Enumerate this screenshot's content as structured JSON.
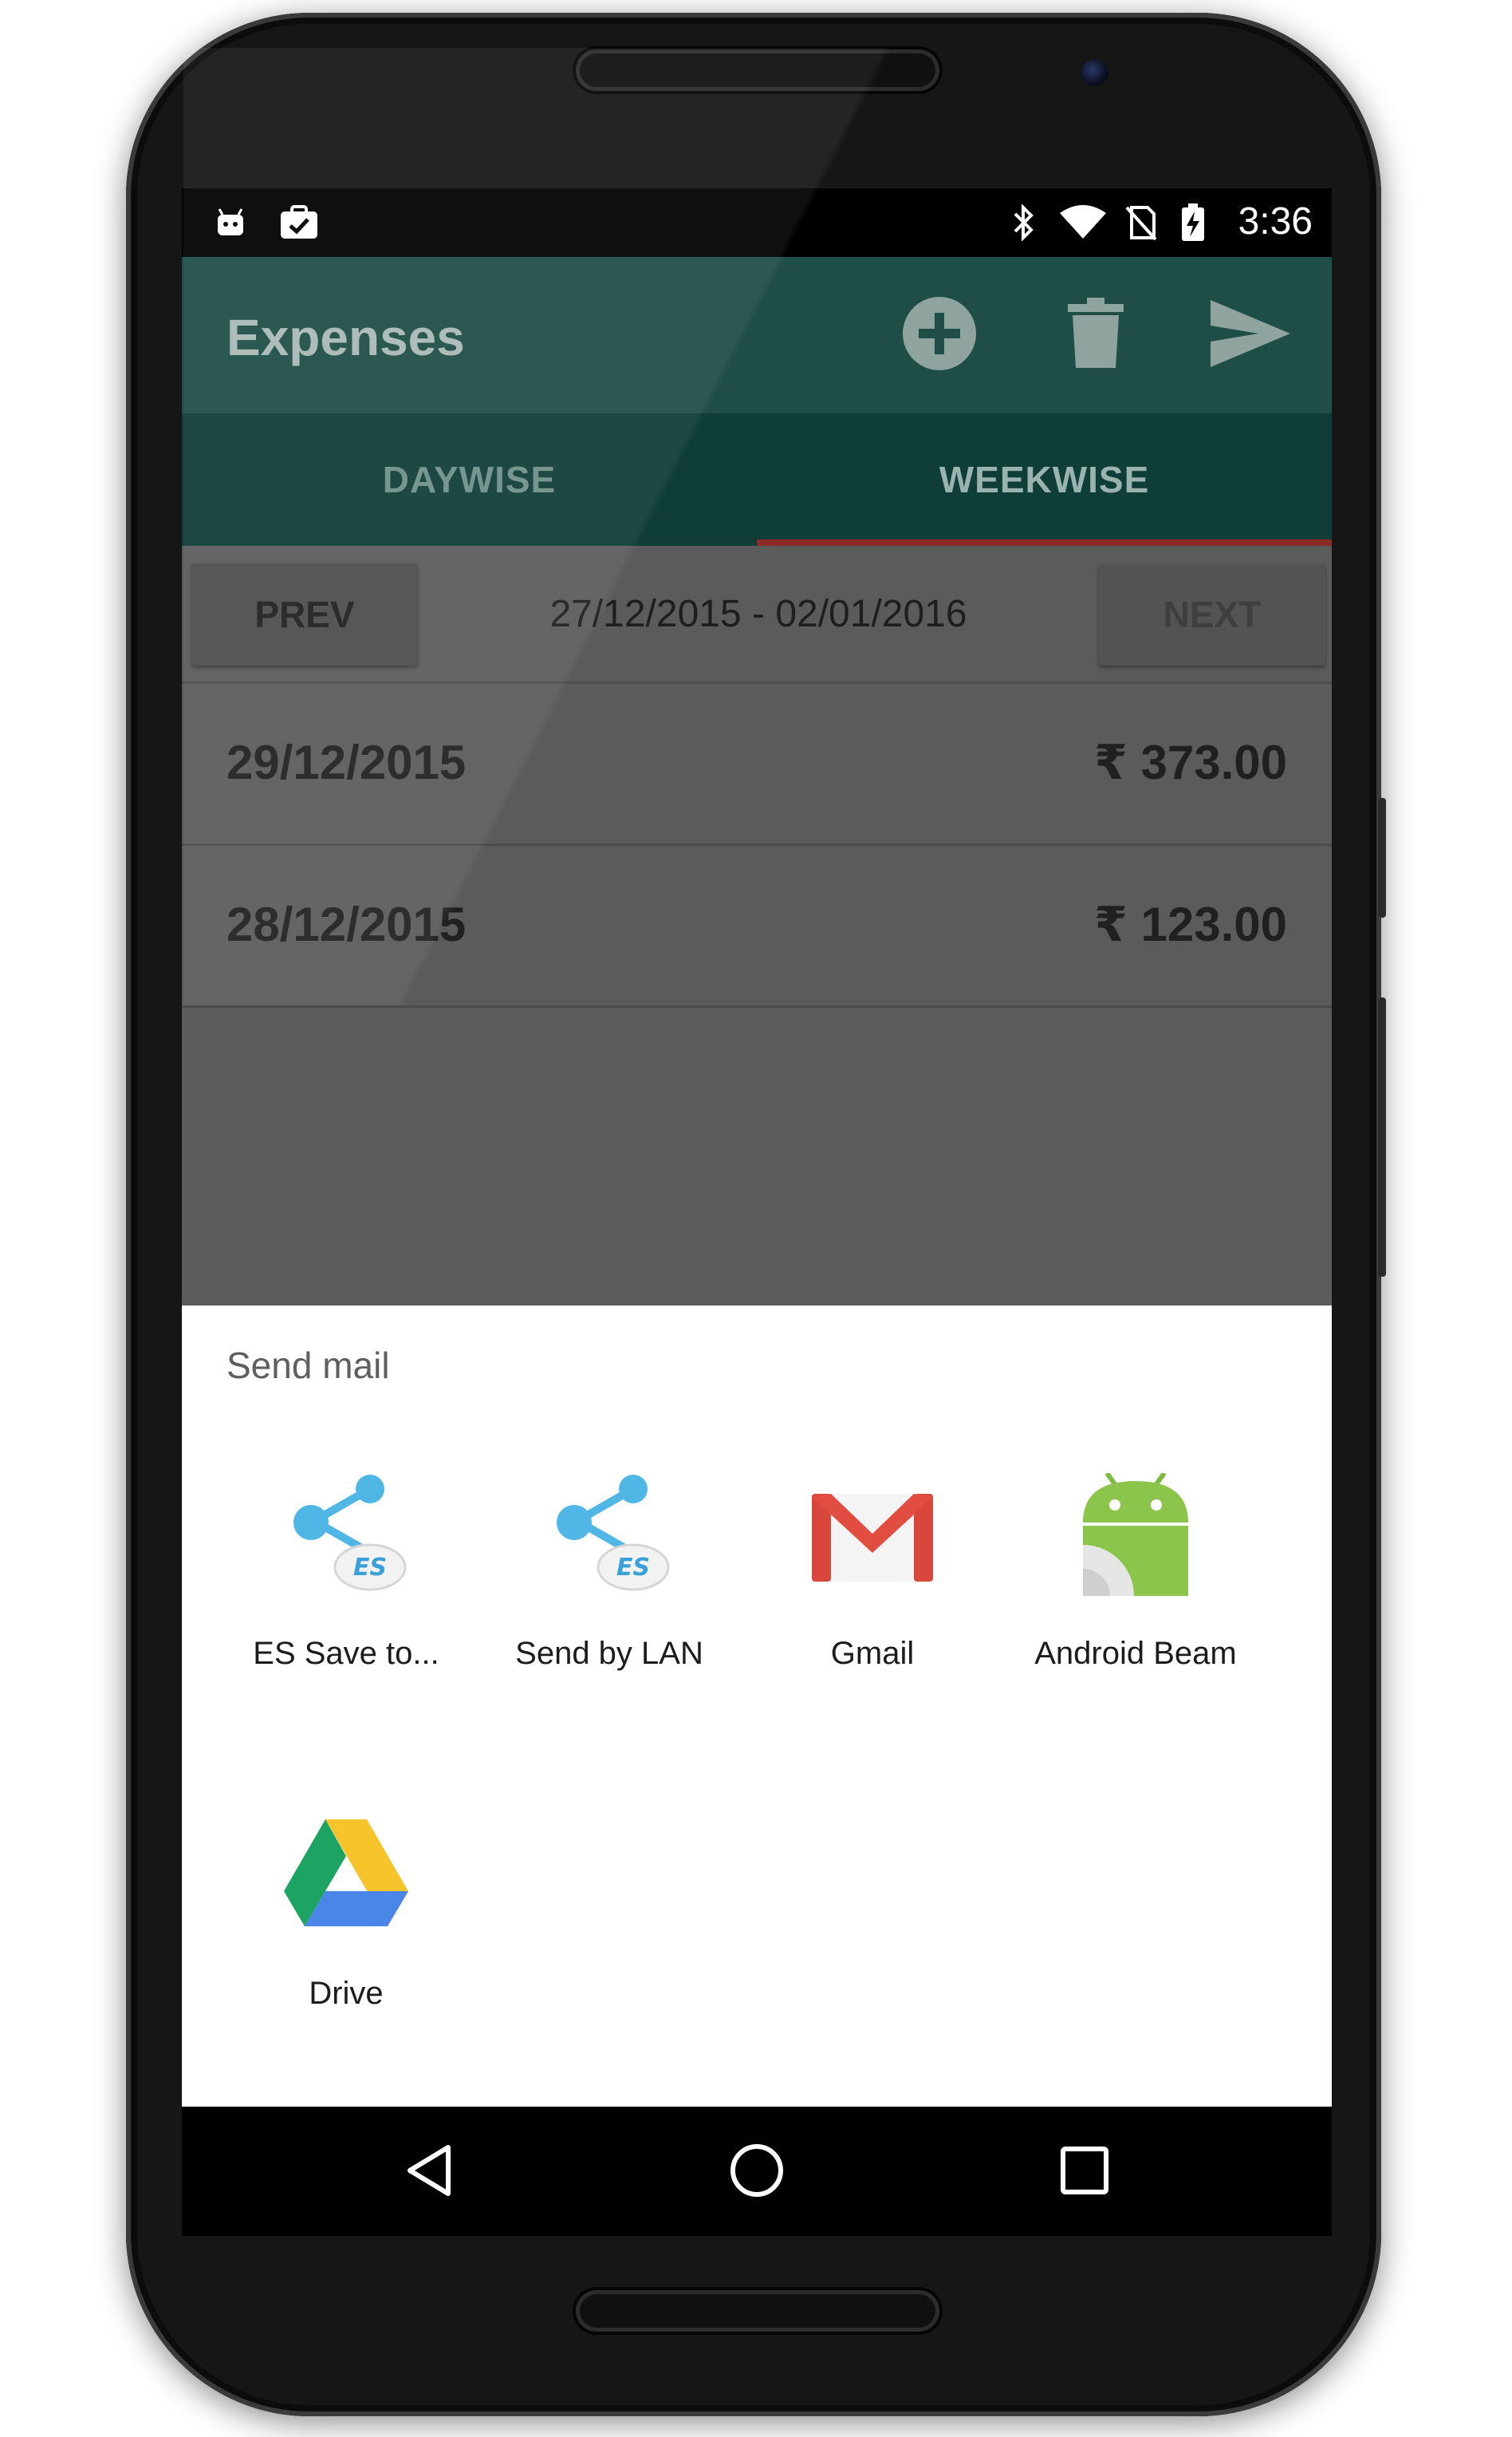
{
  "status_bar": {
    "time": "3:36",
    "left_icons": [
      "android-notification-icon",
      "clipboard-check-icon"
    ],
    "right_icons": [
      "bluetooth-icon",
      "wifi-icon",
      "no-sim-icon",
      "battery-charging-icon"
    ]
  },
  "app_bar": {
    "title": "Expenses",
    "actions": [
      "add-circle-icon",
      "delete-icon",
      "send-icon"
    ],
    "color": "#1f4e47"
  },
  "tabs": [
    {
      "label": "DAYWISE",
      "active": false
    },
    {
      "label": "WEEKWISE",
      "active": true
    }
  ],
  "week_nav": {
    "prev_label": "PREV",
    "next_label": "NEXT",
    "range": "27/12/2015 - 02/01/2016"
  },
  "expenses": [
    {
      "date": "29/12/2015",
      "amount": "₹ 373.00"
    },
    {
      "date": "28/12/2015",
      "amount": "₹ 123.00"
    }
  ],
  "share_sheet": {
    "title": "Send mail",
    "targets": [
      {
        "label": "ES Save to...",
        "icon": "es-share-icon"
      },
      {
        "label": "Send by LAN",
        "icon": "es-share-icon"
      },
      {
        "label": "Gmail",
        "icon": "gmail-icon"
      },
      {
        "label": "Android Beam",
        "icon": "android-beam-icon"
      },
      {
        "label": "Drive",
        "icon": "google-drive-icon"
      }
    ]
  },
  "nav_bar": {
    "buttons": [
      "back-icon",
      "home-icon",
      "recents-icon"
    ]
  }
}
